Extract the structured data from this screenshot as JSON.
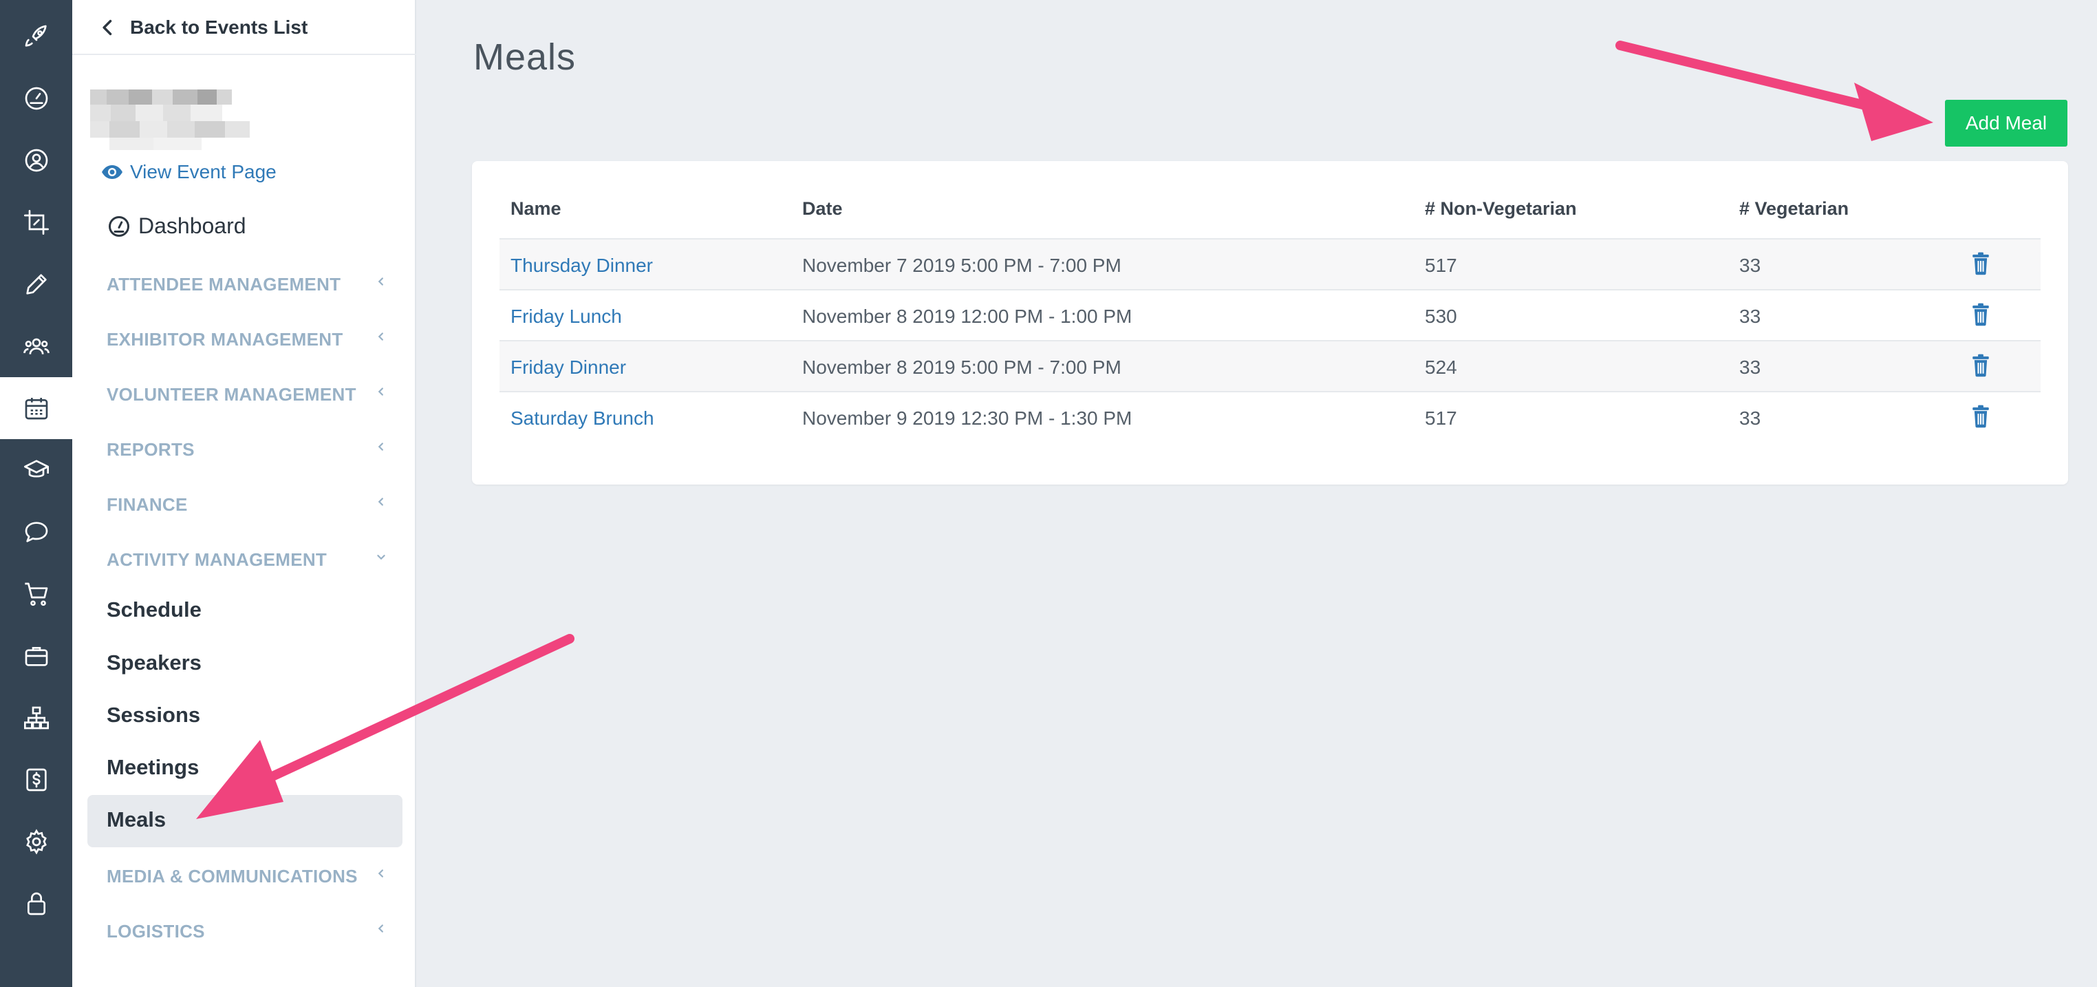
{
  "sidebar": {
    "back_label": "Back to Events List",
    "view_event_label": "View Event Page",
    "dashboard_label": "Dashboard",
    "sections": [
      {
        "label": "ATTENDEE MANAGEMENT",
        "expanded": false
      },
      {
        "label": "EXHIBITOR MANAGEMENT",
        "expanded": false
      },
      {
        "label": "VOLUNTEER MANAGEMENT",
        "expanded": false
      },
      {
        "label": "REPORTS",
        "expanded": false
      },
      {
        "label": "FINANCE",
        "expanded": false
      },
      {
        "label": "ACTIVITY MANAGEMENT",
        "expanded": true
      }
    ],
    "activity_items": [
      "Schedule",
      "Speakers",
      "Sessions",
      "Meetings",
      "Meals"
    ],
    "active_item": "Meals",
    "sections_after": [
      {
        "label": "MEDIA & COMMUNICATIONS",
        "expanded": false
      },
      {
        "label": "LOGISTICS",
        "expanded": false
      }
    ]
  },
  "rail_icons": [
    "rocket-icon",
    "speedometer-icon",
    "user-circle-icon",
    "crop-icon",
    "pencil-icon",
    "users-icon",
    "calendar-icon",
    "graduation-cap-icon",
    "chat-bubble-icon",
    "cart-icon",
    "briefcase-icon",
    "sitemap-icon",
    "dollar-icon",
    "gear-icon",
    "lock-icon"
  ],
  "rail_active": "calendar-icon",
  "main": {
    "title": "Meals",
    "add_button_label": "Add Meal",
    "table": {
      "headers": [
        "Name",
        "Date",
        "# Non-Vegetarian",
        "# Vegetarian"
      ],
      "rows": [
        {
          "name": "Thursday Dinner",
          "date": "November 7 2019 5:00 PM - 7:00 PM",
          "non_veg": "517",
          "veg": "33"
        },
        {
          "name": "Friday Lunch",
          "date": "November 8 2019 12:00 PM - 1:00 PM",
          "non_veg": "530",
          "veg": "33"
        },
        {
          "name": "Friday Dinner",
          "date": "November 8 2019 5:00 PM - 7:00 PM",
          "non_veg": "524",
          "veg": "33"
        },
        {
          "name": "Saturday Brunch",
          "date": "November 9 2019 12:30 PM - 1:30 PM",
          "non_veg": "517",
          "veg": "33"
        }
      ]
    }
  },
  "colors": {
    "rail_bg": "#344453",
    "accent_link": "#2f79b7",
    "add_button": "#16c465",
    "annotation_arrow": "#f0437d",
    "section_label": "#98b1c6"
  }
}
